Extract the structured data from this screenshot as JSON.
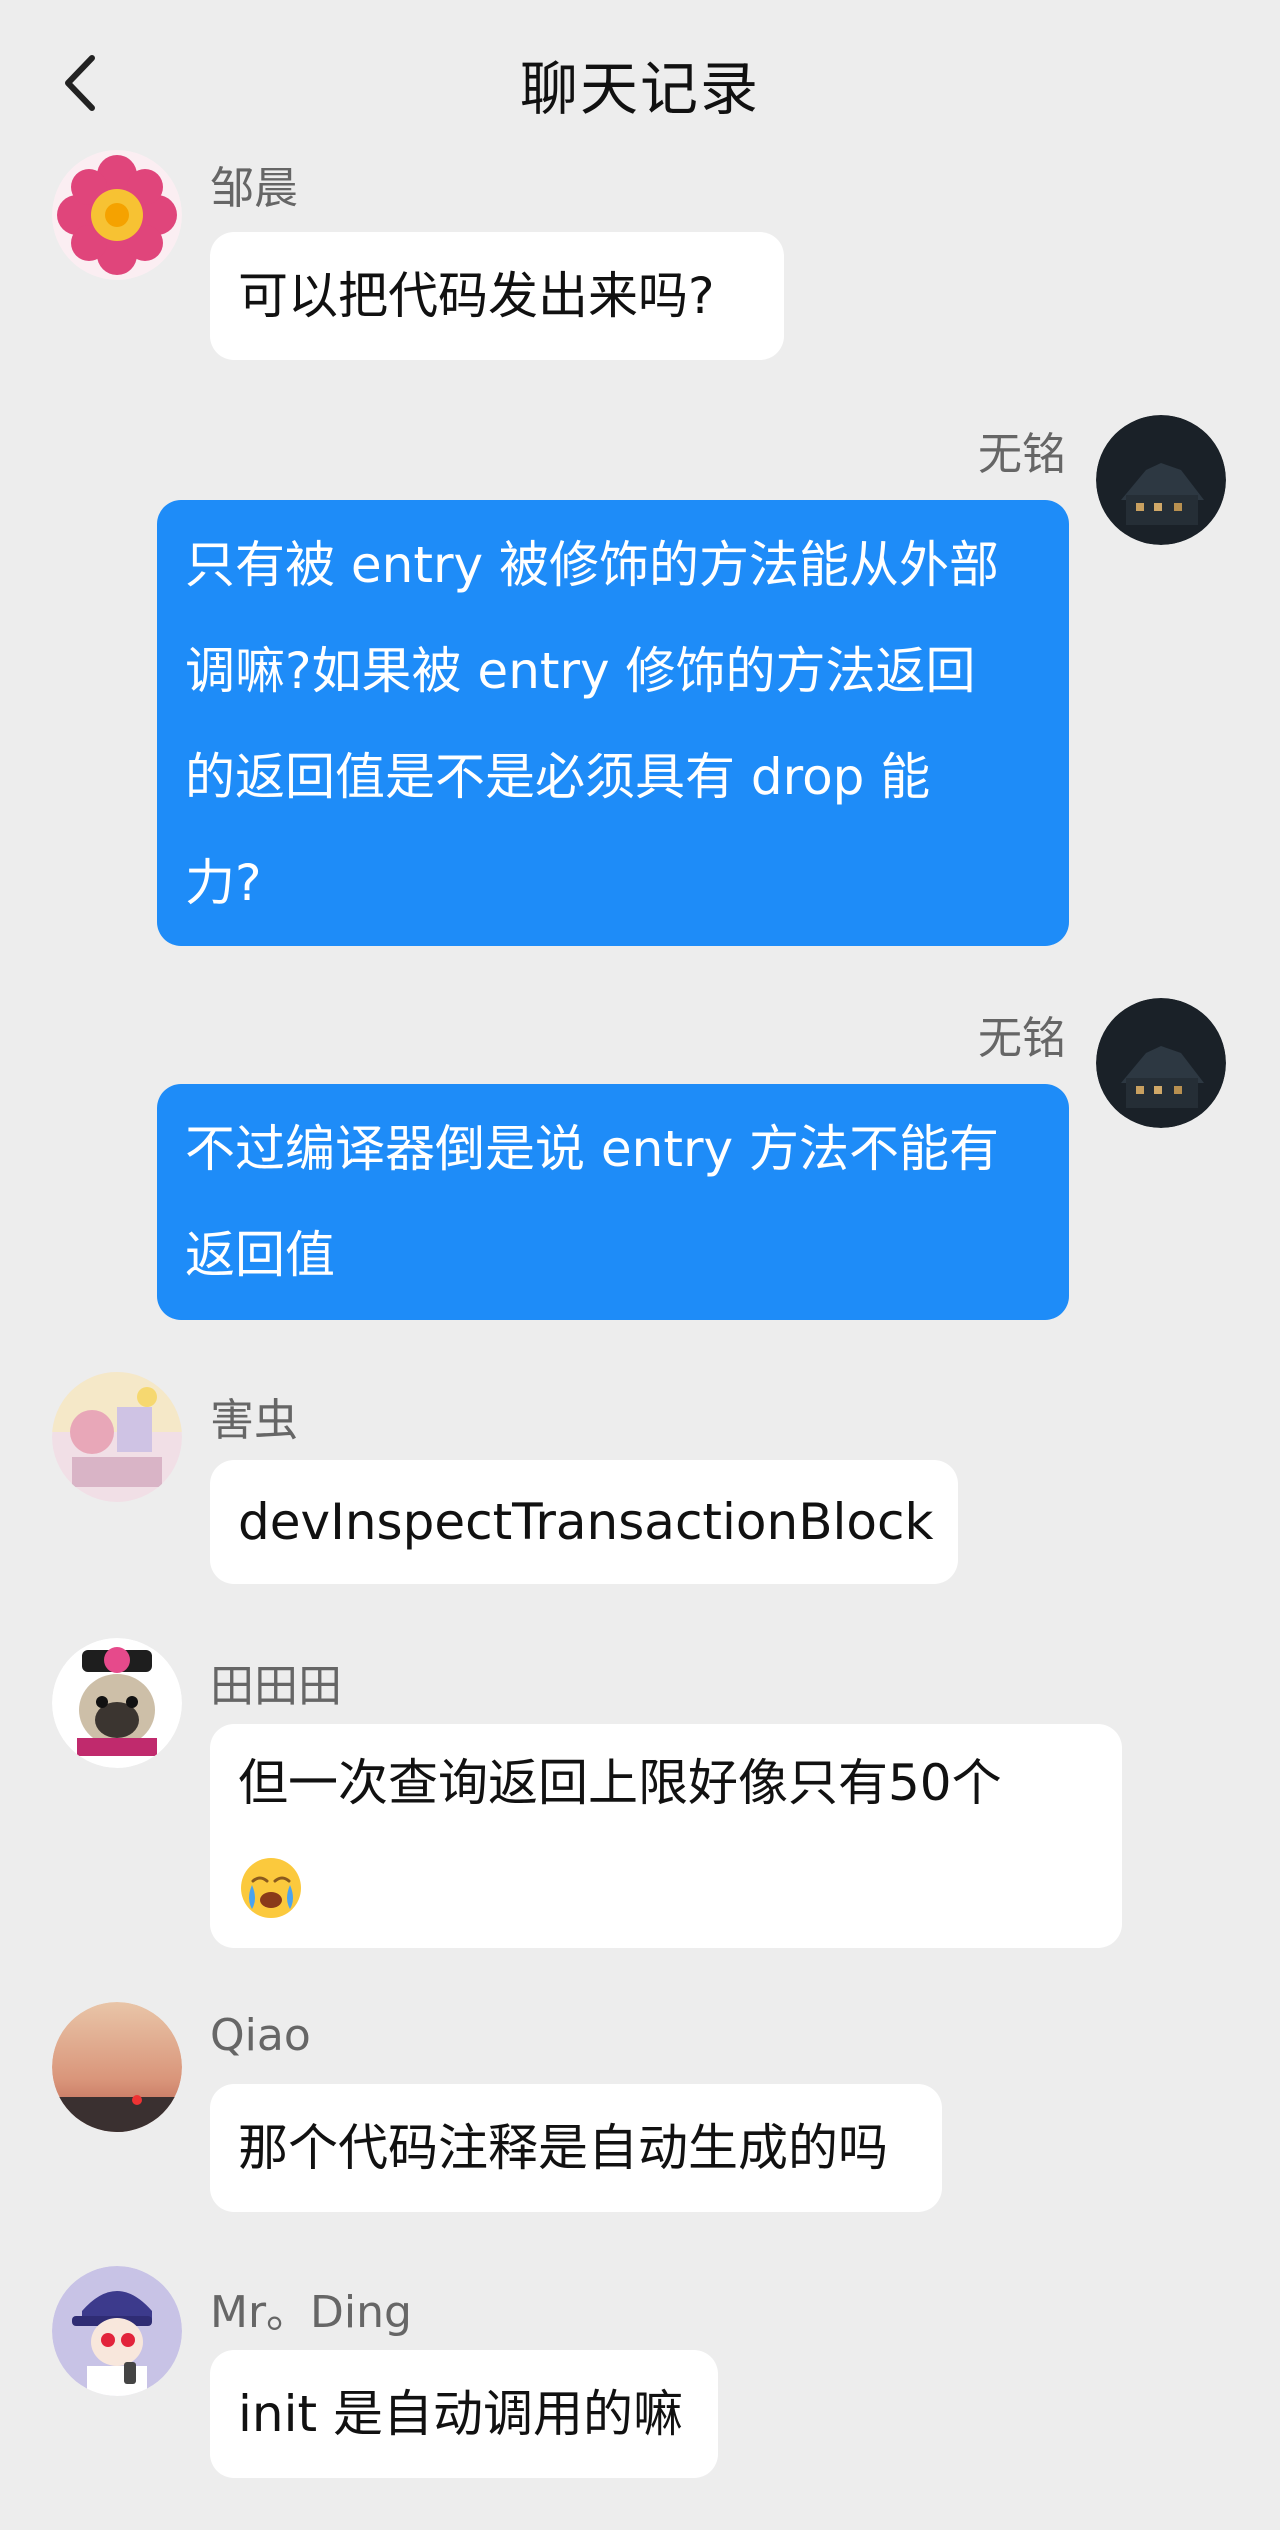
{
  "header": {
    "title": "聊天记录",
    "back_icon": "chevron-left-icon"
  },
  "messages": [
    {
      "sender": "邹晨",
      "side": "left",
      "avatar": "flower-mandala-avatar",
      "lines": [
        "可以把代码发出来吗?"
      ]
    },
    {
      "sender": "无铭",
      "side": "right",
      "avatar": "dark-house-avatar",
      "lines": [
        "只有被 entry 被修饰的方法能从外部",
        "调嘛?如果被 entry 修饰的方法返回",
        "的返回值是不是必须具有 drop 能",
        "力?"
      ]
    },
    {
      "sender": "无铭",
      "side": "right",
      "avatar": "dark-house-avatar",
      "lines": [
        "不过编译器倒是说 entry 方法不能有",
        "返回值"
      ]
    },
    {
      "sender": "害虫",
      "side": "left",
      "avatar": "anime-room-avatar",
      "lines": [
        "devInspectTransactionBlock"
      ]
    },
    {
      "sender": "田田田",
      "side": "left",
      "avatar": "pug-avatar",
      "lines": [
        "但一次查询返回上限好像只有50个"
      ],
      "emoji": "crying-face-icon"
    },
    {
      "sender": "Qiao",
      "side": "left",
      "avatar": "sunset-avatar",
      "lines": [
        "那个代码注释是自动生成的吗"
      ]
    },
    {
      "sender": "Mr。Ding",
      "side": "left",
      "avatar": "cartoon-person-avatar",
      "lines": [
        "init 是自动调用的嘛"
      ]
    }
  ],
  "colors": {
    "background": "#ededed",
    "bubble_left": "#ffffff",
    "bubble_right": "#1e8cf8",
    "sender_text": "#666666"
  }
}
